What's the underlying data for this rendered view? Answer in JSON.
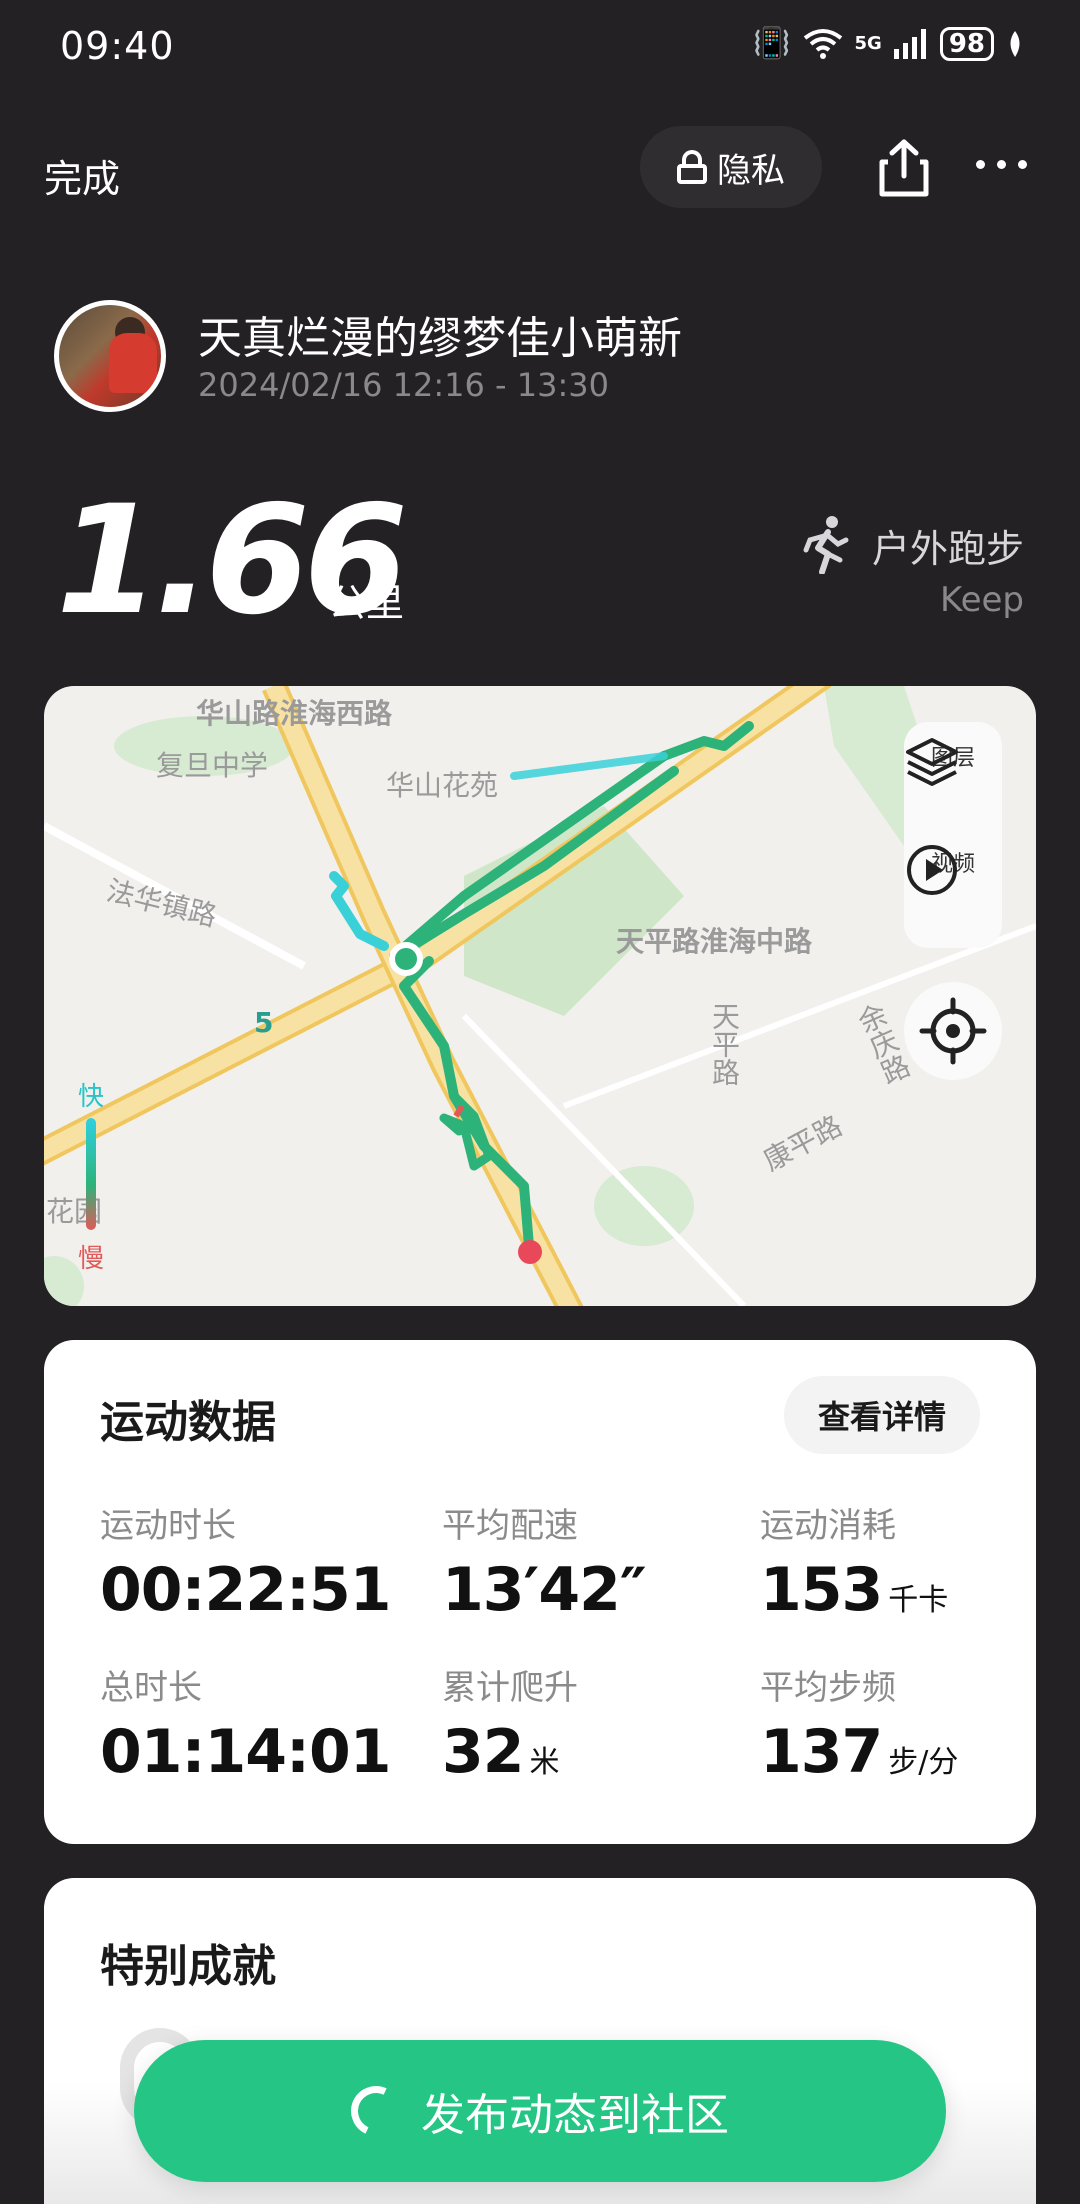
{
  "status_bar": {
    "time": "09:40",
    "network": "5G",
    "battery": "98"
  },
  "topbar": {
    "done_label": "完成",
    "privacy_label": "隐私"
  },
  "profile": {
    "name": "天真烂漫的缪梦佳小萌新",
    "time_range": "2024/02/16 12:16 - 13:30"
  },
  "summary": {
    "distance": "1.66",
    "distance_unit": "公里",
    "activity_type": "户外跑步",
    "source": "Keep"
  },
  "map": {
    "labels": {
      "road_1": "华山路淮海西路",
      "school": "复旦中学",
      "garden": "华山花苑",
      "road_2": "法华镇路",
      "road_3": "天平路淮海中路",
      "road_4": "天平路",
      "road_5": "余庆路",
      "road_6": "康平路",
      "marker_5": "5",
      "garden_2": "花园"
    },
    "controls": {
      "layers_label": "图层",
      "video_label": "视频"
    },
    "speed_legend": {
      "fast": "快",
      "slow": "慢"
    },
    "colors": {
      "route": "#2db37a",
      "route_fast": "#2fd0e0",
      "start": "#2db37a",
      "end": "#e8485a",
      "road": "#f3d27a"
    }
  },
  "sports_data": {
    "title": "运动数据",
    "detail_button": "查看详情",
    "stats": [
      {
        "label": "运动时长",
        "value": "00:22:51",
        "unit": ""
      },
      {
        "label": "平均配速",
        "value": "13′42″",
        "unit": ""
      },
      {
        "label": "运动消耗",
        "value": "153",
        "unit": "千卡"
      },
      {
        "label": "总时长",
        "value": "01:14:01",
        "unit": ""
      },
      {
        "label": "累计爬升",
        "value": "32",
        "unit": "米"
      },
      {
        "label": "平均步频",
        "value": "137",
        "unit": "步/分"
      }
    ]
  },
  "achievements": {
    "title": "特别成就"
  },
  "publish": {
    "label": "发布动态到社区",
    "color": "#25c685"
  }
}
